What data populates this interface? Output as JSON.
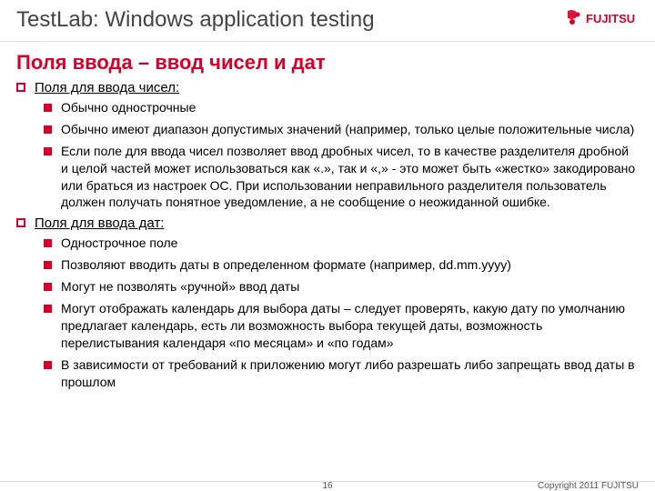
{
  "header": {
    "title": "TestLab: Windows application testing",
    "logo_text": "FUJITSU"
  },
  "subtitle": "Поля ввода – ввод чисел и дат",
  "sections": [
    {
      "title": "Поля для ввода чисел:",
      "items": [
        "Обычно однострочные",
        "Обычно имеют диапазон допустимых значений (например, только целые положительные числа)",
        "Если поле для ввода чисел позволяет ввод дробных чисел, то в качестве разделителя дробной и целой частей может использоваться как «.», так и «,» - это может быть «жестко» закодировано или браться из настроек ОС. При использовании неправильного разделителя пользователь должен получать понятное уведомление, а не сообщение о неожиданной ошибке."
      ]
    },
    {
      "title": "Поля для ввода дат:",
      "items": [
        "Однострочное поле",
        "Позволяют вводить даты в определенном формате (например, dd.mm.yyyy)",
        "Могут не позволять «ручной» ввод даты",
        "Могут отображать календарь для выбора даты – следует проверять, какую дату по умолчанию предлагает календарь, есть ли возможность выбора текущей даты, возможность перелистывания календаря «по месяцам» и «по годам»",
        "В зависимости от требований к приложению могут либо разрешать либо запрещать ввод даты в прошлом"
      ]
    }
  ],
  "footer": {
    "page": "16",
    "copyright": "Copyright 2011 FUJITSU"
  }
}
